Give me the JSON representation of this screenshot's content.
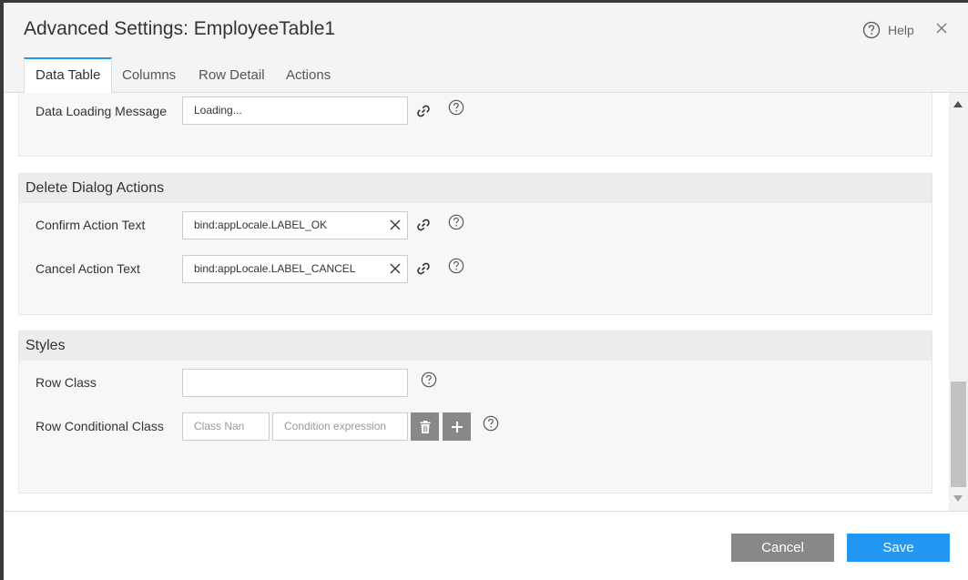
{
  "dialog": {
    "title": "Advanced Settings: EmployeeTable1",
    "help_label": "Help",
    "close_icon": "close-icon",
    "help_icon": "question-circle-icon"
  },
  "tabs": [
    {
      "label": "Data Table",
      "active": true
    },
    {
      "label": "Columns",
      "active": false
    },
    {
      "label": "Row Detail",
      "active": false
    },
    {
      "label": "Actions",
      "active": false
    }
  ],
  "data_section": {
    "loading_label": "Data Loading Message",
    "loading_value": "Loading..."
  },
  "delete_section": {
    "title": "Delete Dialog Actions",
    "confirm_label": "Confirm Action Text",
    "confirm_value": "bind:appLocale.LABEL_OK",
    "cancel_label": "Cancel Action Text",
    "cancel_value": "bind:appLocale.LABEL_CANCEL"
  },
  "styles_section": {
    "title": "Styles",
    "row_class_label": "Row Class",
    "row_class_value": "",
    "row_conditional_label": "Row Conditional Class",
    "class_name_placeholder": "Class Nan",
    "condition_placeholder": "Condition expression"
  },
  "footer": {
    "cancel_label": "Cancel",
    "save_label": "Save"
  },
  "colors": {
    "accent": "#2196f3",
    "secondary_button": "#888888",
    "section_bg": "#f7f7f7",
    "header_bg": "#f4f4f4"
  }
}
